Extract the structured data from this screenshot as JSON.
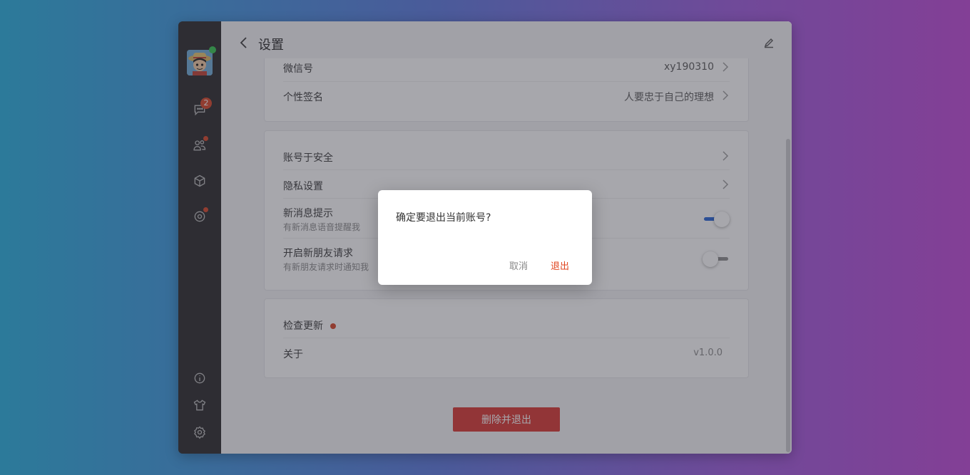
{
  "header": {
    "title": "设置"
  },
  "sidebar": {
    "message_badge": "2"
  },
  "card1": {
    "rows": [
      {
        "label": "微信号",
        "value": "xy190310"
      },
      {
        "label": "个性签名",
        "value": "人要忠于自己的理想"
      }
    ]
  },
  "card2": {
    "rows": [
      {
        "label": "账号于安全"
      },
      {
        "label": "隐私设置"
      },
      {
        "label": "新消息提示",
        "sub": "有新消息语音提醒我",
        "toggle_on": true
      },
      {
        "label": "开启新朋友请求",
        "sub": "有新朋友请求时通知我",
        "toggle_on": false
      }
    ]
  },
  "card3": {
    "rows": [
      {
        "label": "检查更新"
      },
      {
        "label": "关于",
        "value": "v1.0.0"
      }
    ]
  },
  "danger_button": "删除并退出",
  "dialog": {
    "message": "确定要退出当前账号?",
    "cancel": "取消",
    "confirm": "退出"
  },
  "colors": {
    "accent": "#1f5fd6",
    "danger": "#d9312a",
    "badge": "#d83f1f",
    "online": "#2fc34a"
  }
}
